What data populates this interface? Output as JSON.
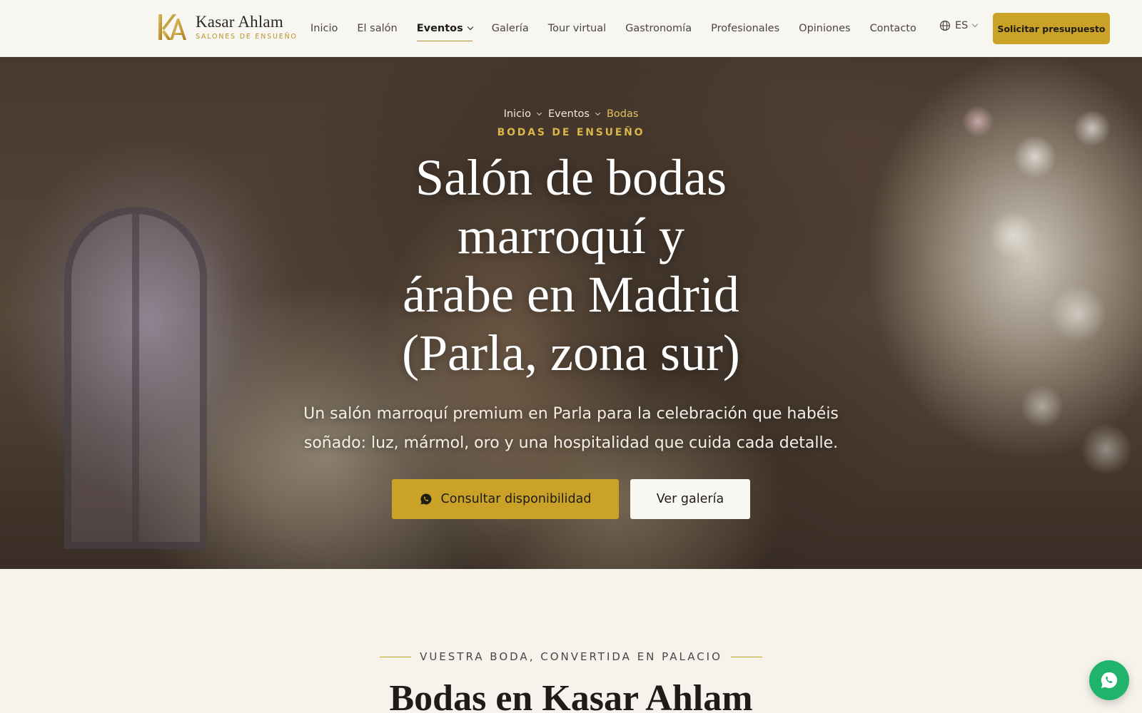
{
  "brand": {
    "name": "Kasar Ahlam",
    "tagline": "SALONES DE ENSUEÑO",
    "accent_color": "#c9a227"
  },
  "nav": {
    "items": [
      {
        "label": "Inicio"
      },
      {
        "label": "El salón"
      },
      {
        "label": "Eventos",
        "active": true,
        "dropdown": true
      },
      {
        "label": "Galería"
      },
      {
        "label": "Tour virtual"
      },
      {
        "label": "Gastronomía"
      },
      {
        "label": "Profesionales"
      },
      {
        "label": "Opiniones"
      },
      {
        "label": "Contacto"
      }
    ],
    "language": "ES",
    "cta_label": "Solicitar presupuesto"
  },
  "hero": {
    "breadcrumb": [
      "Inicio",
      "Eventos",
      "Bodas"
    ],
    "eyebrow": "BODAS DE ENSUEÑO",
    "title_lines": [
      "Salón de bodas",
      "marroquí y",
      "árabe en Madrid",
      "(Parla, zona sur)"
    ],
    "subtitle_lines": [
      "Un salón marroquí premium en Parla para la celebración que habéis",
      "soñado: luz, mármol, oro y una hospitalidad que cuida cada detalle."
    ],
    "primary_button": "Consultar disponibilidad",
    "secondary_button": "Ver galería"
  },
  "section": {
    "eyebrow": "VUESTRA BODA, CONVERTIDA EN PALACIO",
    "title": "Bodas en Kasar Ahlam"
  },
  "icons": {
    "logo": "ka-monogram-icon",
    "language": "globe-icon",
    "whatsapp": "whatsapp-icon"
  },
  "colors": {
    "whatsapp": "#1fb36b",
    "breadcrumb_current": "#e2c25e"
  }
}
